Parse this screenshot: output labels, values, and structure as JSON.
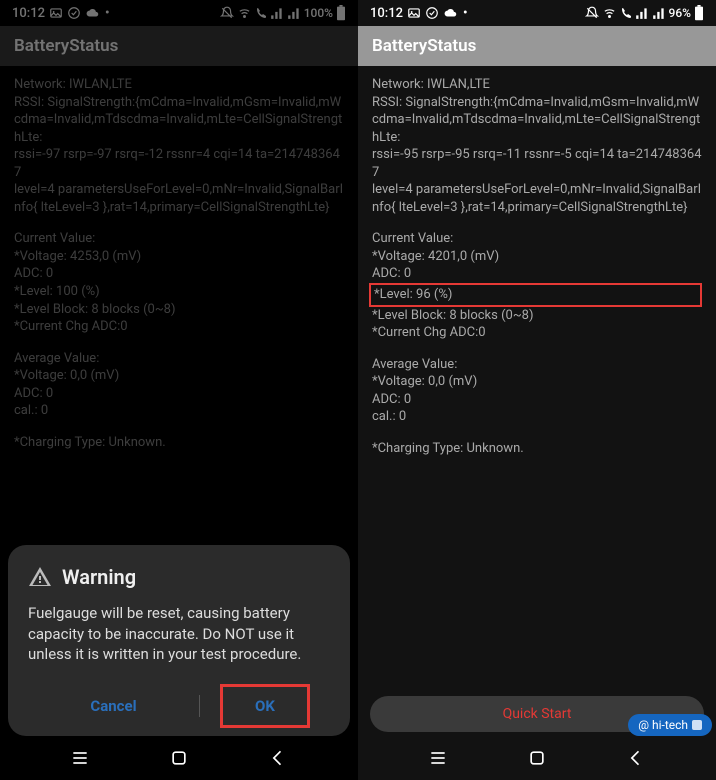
{
  "left": {
    "statusbar": {
      "time": "10:12",
      "battery": "100%"
    },
    "header": {
      "title": "BatteryStatus"
    },
    "body": {
      "network_label": "Network: IWLAN,LTE",
      "rssi_line1": "RSSI: SignalStrength:{mCdma=Invalid,mGsm=Invalid,mWcdma=Invalid,mTdscdma=Invalid,mLte=CellSignalStrengthLte:",
      "rssi_line2": "rssi=-97 rsrp=-97 rsrq=-12 rssnr=4 cqi=14 ta=2147483647",
      "rssi_line3": "level=4 parametersUseForLevel=0,mNr=Invalid,SignalBarInfo{ lteLevel=3 },rat=14,primary=CellSignalStrengthLte}",
      "current_label": "Current Value:",
      "cv_voltage": "*Voltage:  4253,0 (mV)",
      "cv_adc": "   ADC:  0",
      "cv_level": "*Level: 100 (%)",
      "cv_block": "*Level Block: 8 blocks (0~8)",
      "cv_chg": "*Current Chg ADC:0",
      "avg_label": "Average Value:",
      "av_voltage": "*Voltage:  0,0 (mV)",
      "av_adc": "   ADC:  0",
      "av_cal": "   cal.:  0",
      "chg_type": "*Charging Type: Unknown."
    },
    "dialog": {
      "title": "Warning",
      "body_l1": "Fuelgauge will be reset, causing battery capacity to be inaccurate.",
      "body_l2": "Do NOT use it unless it is written in your test procedure.",
      "cancel": "Cancel",
      "ok": "OK"
    }
  },
  "right": {
    "statusbar": {
      "time": "10:12",
      "battery": "96%"
    },
    "header": {
      "title": "BatteryStatus"
    },
    "body": {
      "network_label": "Network: IWLAN,LTE",
      "rssi_line1": "RSSI: SignalStrength:{mCdma=Invalid,mGsm=Invalid,mWcdma=Invalid,mTdscdma=Invalid,mLte=CellSignalStrengthLte:",
      "rssi_line2": "rssi=-95 rsrp=-95 rsrq=-11 rssnr=-5 cqi=14 ta=2147483647",
      "rssi_line3": "level=4 parametersUseForLevel=0,mNr=Invalid,SignalBarInfo{ lteLevel=3 },rat=14,primary=CellSignalStrengthLte}",
      "current_label": "Current Value:",
      "cv_voltage": "*Voltage:  4201,0 (mV)",
      "cv_adc": "   ADC:  0",
      "cv_level": "*Level: 96 (%)",
      "cv_block": "*Level Block: 8 blocks (0~8)",
      "cv_chg": "*Current Chg ADC:0",
      "avg_label": "Average Value:",
      "av_voltage": "*Voltage:  0,0 (mV)",
      "av_adc": "   ADC:  0",
      "av_cal": "   cal.:  0",
      "chg_type": "*Charging Type: Unknown."
    },
    "quick_start": "Quick Start",
    "watermark": "@ hi-tech"
  }
}
